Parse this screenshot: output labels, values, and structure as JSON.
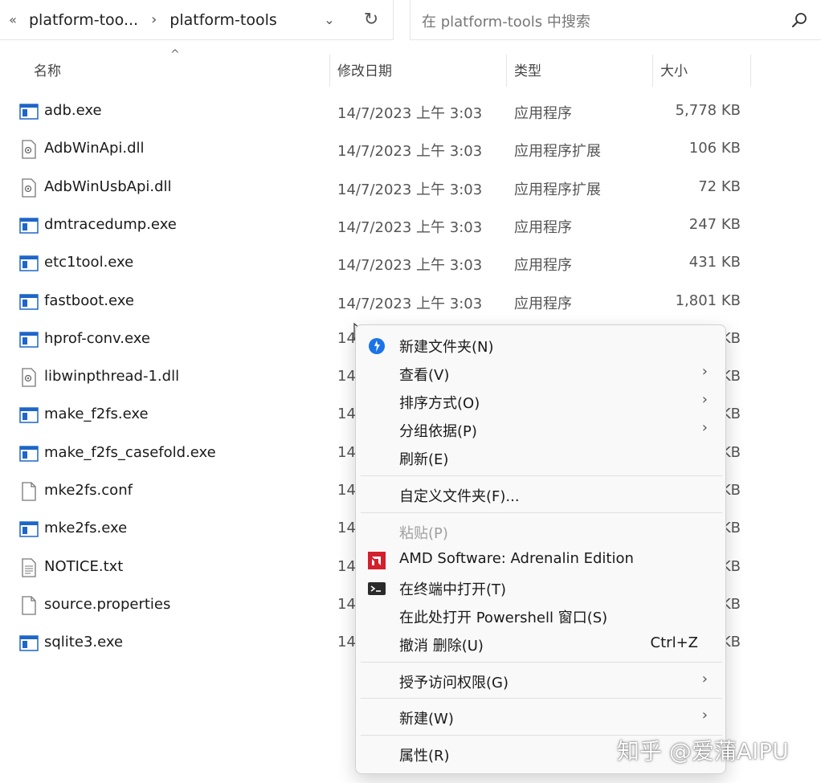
{
  "address_bar": {
    "back_glyph": "«",
    "crumbs": [
      "platform-too...",
      "platform-tools"
    ],
    "separator": "›",
    "dropdown_glyph": "⌄",
    "refresh_glyph": "↻"
  },
  "search": {
    "placeholder": "在 platform-tools 中搜索",
    "icon": "search-icon"
  },
  "columns": {
    "name": "名称",
    "date": "修改日期",
    "type": "类型",
    "size": "大小",
    "sort_indicator": "^"
  },
  "files": [
    {
      "name": "adb.exe",
      "date": "14/7/2023 上午 3:03",
      "type": "应用程序",
      "size": "5,778 KB",
      "icon": "exe-icon"
    },
    {
      "name": "AdbWinApi.dll",
      "date": "14/7/2023 上午 3:03",
      "type": "应用程序扩展",
      "size": "106 KB",
      "icon": "dll-icon"
    },
    {
      "name": "AdbWinUsbApi.dll",
      "date": "14/7/2023 上午 3:03",
      "type": "应用程序扩展",
      "size": "72 KB",
      "icon": "dll-icon"
    },
    {
      "name": "dmtracedump.exe",
      "date": "14/7/2023 上午 3:03",
      "type": "应用程序",
      "size": "247 KB",
      "icon": "exe-icon"
    },
    {
      "name": "etc1tool.exe",
      "date": "14/7/2023 上午 3:03",
      "type": "应用程序",
      "size": "431 KB",
      "icon": "exe-icon"
    },
    {
      "name": "fastboot.exe",
      "date": "14/7/2023 上午 3:03",
      "type": "应用程序",
      "size": "1,801 KB",
      "icon": "exe-icon"
    },
    {
      "name": "hprof-conv.exe",
      "date": "14",
      "type": "",
      "size": "KB",
      "icon": "exe-icon"
    },
    {
      "name": "libwinpthread-1.dll",
      "date": "14",
      "type": "",
      "size": "KB",
      "icon": "dll-icon"
    },
    {
      "name": "make_f2fs.exe",
      "date": "14",
      "type": "",
      "size": "KB",
      "icon": "exe-icon"
    },
    {
      "name": "make_f2fs_casefold.exe",
      "date": "14",
      "type": "",
      "size": "KB",
      "icon": "exe-icon"
    },
    {
      "name": "mke2fs.conf",
      "date": "14",
      "type": "",
      "size": "KB",
      "icon": "file-icon"
    },
    {
      "name": "mke2fs.exe",
      "date": "14",
      "type": "",
      "size": "KB",
      "icon": "exe-icon"
    },
    {
      "name": "NOTICE.txt",
      "date": "14",
      "type": "",
      "size": "KB",
      "icon": "text-file-icon"
    },
    {
      "name": "source.properties",
      "date": "14",
      "type": "",
      "size": "KB",
      "icon": "file-icon"
    },
    {
      "name": "sqlite3.exe",
      "date": "14",
      "type": "",
      "size": "KB",
      "icon": "exe-icon"
    }
  ],
  "context_menu": {
    "items": [
      {
        "label": "新建文件夹(N)",
        "icon": "new-folder-icon"
      },
      {
        "label": "查看(V)",
        "arrow": "›"
      },
      {
        "label": "排序方式(O)",
        "arrow": "›"
      },
      {
        "label": "分组依据(P)",
        "arrow": "›"
      },
      {
        "label": "刷新(E)"
      },
      {
        "label": "自定义文件夹(F)..."
      },
      {
        "label": "粘贴(P)",
        "disabled": true
      },
      {
        "label": "AMD Software: Adrenalin Edition",
        "icon": "amd-icon"
      },
      {
        "label": "在终端中打开(T)",
        "icon": "terminal-icon"
      },
      {
        "label": "在此处打开 Powershell 窗口(S)"
      },
      {
        "label": "撤消 删除(U)",
        "shortcut": "Ctrl+Z"
      },
      {
        "label": "授予访问权限(G)",
        "arrow": "›"
      },
      {
        "label": "新建(W)",
        "arrow": "›"
      },
      {
        "label": "属性(R)"
      }
    ]
  },
  "watermark": "知乎 @爱蒲AIPU",
  "colors": {
    "exe_icon_blue": "#1e66c8",
    "menu_bg": "#f9f9f9",
    "amd_red": "#d41f2c",
    "new_folder_blue": "#1a73e8"
  }
}
